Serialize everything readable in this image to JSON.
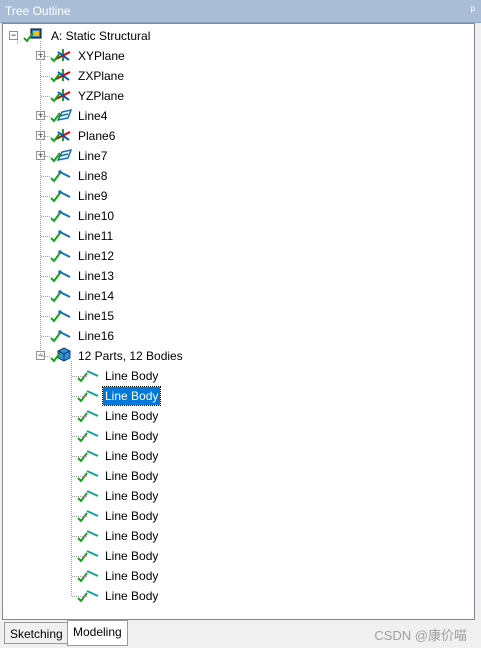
{
  "panel": {
    "title": "Tree Outline",
    "pin": "ᵖ"
  },
  "tree": {
    "root": {
      "label": "A: Static Structural",
      "expander": "−"
    },
    "features": [
      {
        "label": "XYPlane",
        "icon": "plane-icon",
        "expander": "+"
      },
      {
        "label": "ZXPlane",
        "icon": "plane-icon",
        "expander": ""
      },
      {
        "label": "YZPlane",
        "icon": "plane-icon",
        "expander": ""
      },
      {
        "label": "Line4",
        "icon": "lines-from-sketch-icon",
        "expander": "+"
      },
      {
        "label": "Plane6",
        "icon": "plane-icon",
        "expander": "+"
      },
      {
        "label": "Line7",
        "icon": "lines-from-sketch-icon",
        "expander": "+"
      },
      {
        "label": "Line8",
        "icon": "line-icon",
        "expander": ""
      },
      {
        "label": "Line9",
        "icon": "line-icon",
        "expander": ""
      },
      {
        "label": "Line10",
        "icon": "line-icon",
        "expander": ""
      },
      {
        "label": "Line11",
        "icon": "line-icon",
        "expander": ""
      },
      {
        "label": "Line12",
        "icon": "line-icon",
        "expander": ""
      },
      {
        "label": "Line13",
        "icon": "line-icon",
        "expander": ""
      },
      {
        "label": "Line14",
        "icon": "line-icon",
        "expander": ""
      },
      {
        "label": "Line15",
        "icon": "line-icon",
        "expander": ""
      },
      {
        "label": "Line16",
        "icon": "line-icon",
        "expander": ""
      }
    ],
    "parts": {
      "label": "12 Parts, 12 Bodies",
      "icon": "parts-icon",
      "expander": "−"
    },
    "bodies": [
      {
        "label": "Line Body",
        "selected": false
      },
      {
        "label": "Line Body",
        "selected": true
      },
      {
        "label": "Line Body",
        "selected": false
      },
      {
        "label": "Line Body",
        "selected": false
      },
      {
        "label": "Line Body",
        "selected": false
      },
      {
        "label": "Line Body",
        "selected": false
      },
      {
        "label": "Line Body",
        "selected": false
      },
      {
        "label": "Line Body",
        "selected": false
      },
      {
        "label": "Line Body",
        "selected": false
      },
      {
        "label": "Line Body",
        "selected": false
      },
      {
        "label": "Line Body",
        "selected": false
      },
      {
        "label": "Line Body",
        "selected": false
      }
    ]
  },
  "tabs": [
    {
      "label": "Sketching",
      "active": false
    },
    {
      "label": "Modeling",
      "active": true
    }
  ],
  "watermark": "CSDN @康价喵",
  "colors": {
    "selection": "#0078d7",
    "check": "#1aa01a",
    "line_icon": "#1a6fa8",
    "titlebar": "#a9bed6"
  }
}
